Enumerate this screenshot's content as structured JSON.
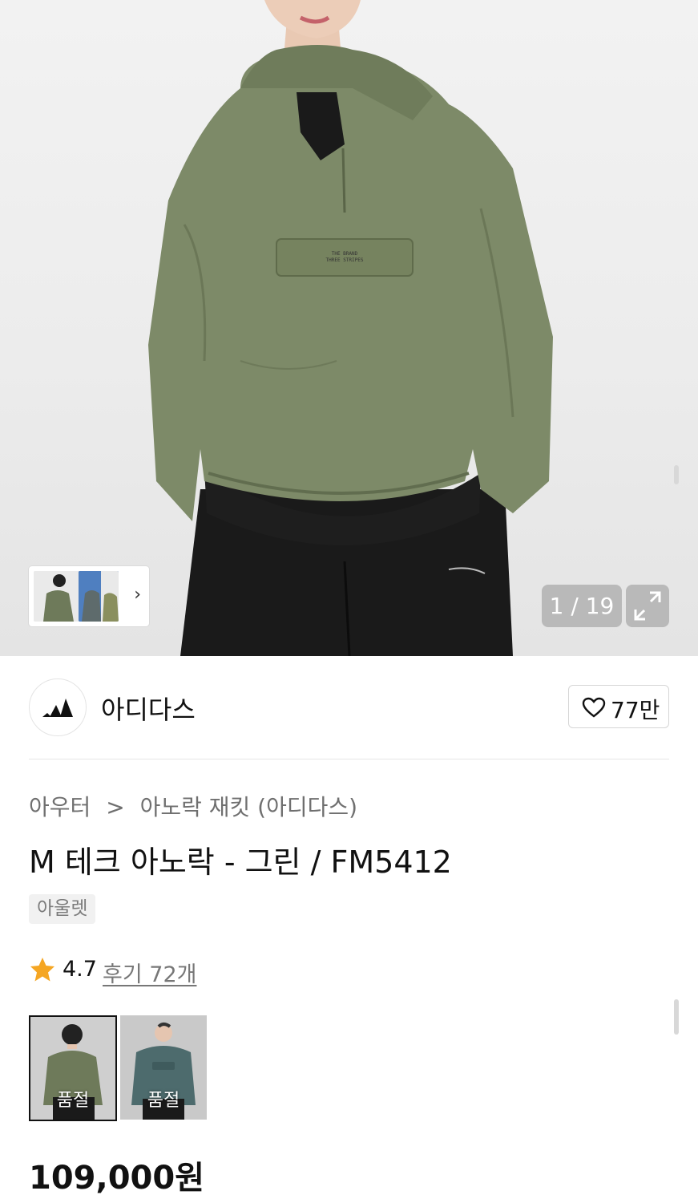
{
  "gallery": {
    "counter": "1 / 19",
    "thumbnail_chevron": "›",
    "expand_icon": "expand-icon"
  },
  "brand": {
    "name": "아디다스",
    "logo_icon": "adidas-logo",
    "likes": "77만"
  },
  "breadcrumb": {
    "category": "아우터",
    "separator": ">",
    "subcategory": "아노락 재킷 (아디다스)"
  },
  "product": {
    "title": "M 테크 아노락 - 그린 / FM5412",
    "tag": "아울렛",
    "rating": "4.7",
    "reviews": "후기 72개",
    "price": "109,000원"
  },
  "color_options": [
    {
      "label": "품절",
      "color": "#6e7a5a"
    },
    {
      "label": "품절",
      "color": "#4d6b6d"
    }
  ],
  "colors": {
    "star": "#f5a623",
    "jacket_green": "#7d8a68",
    "swatch_teal": "#4d6b6d"
  }
}
